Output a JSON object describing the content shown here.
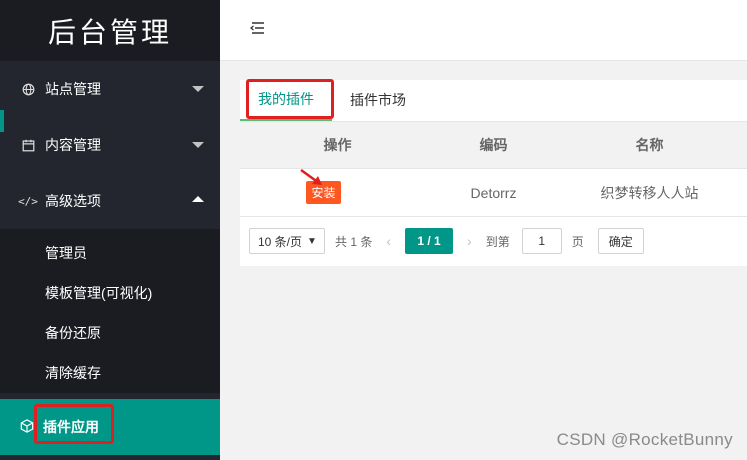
{
  "sidebar": {
    "logo": "后台管理",
    "items": [
      {
        "label": "站点管理",
        "icon": "globe-icon"
      },
      {
        "label": "内容管理",
        "icon": "calendar-icon"
      },
      {
        "label": "高级选项",
        "icon": "code-icon"
      }
    ],
    "submenu": [
      "管理员",
      "模板管理(可视化)",
      "备份还原",
      "清除缓存"
    ],
    "active_item": {
      "label": "插件应用",
      "icon": "cube-icon"
    }
  },
  "topbar": {
    "collapse_icon": "menu-collapse-icon"
  },
  "tabs": [
    "我的插件",
    "插件市场"
  ],
  "table": {
    "headers": [
      "操作",
      "编码",
      "名称"
    ],
    "rows": [
      {
        "action": "安装",
        "code": "Detorrz",
        "name": "织梦转移人人站"
      }
    ]
  },
  "pager": {
    "per_page": "10 条/页",
    "total": "共 1 条",
    "current": "1 / 1",
    "goto_label": "到第",
    "goto_value": "1",
    "page_unit": "页",
    "confirm": "确定"
  },
  "watermark": "CSDN @RocketBunny",
  "colors": {
    "sidebar": "#23262e",
    "accent": "#009688",
    "danger": "#ff5722",
    "highlight": "#e02020"
  }
}
